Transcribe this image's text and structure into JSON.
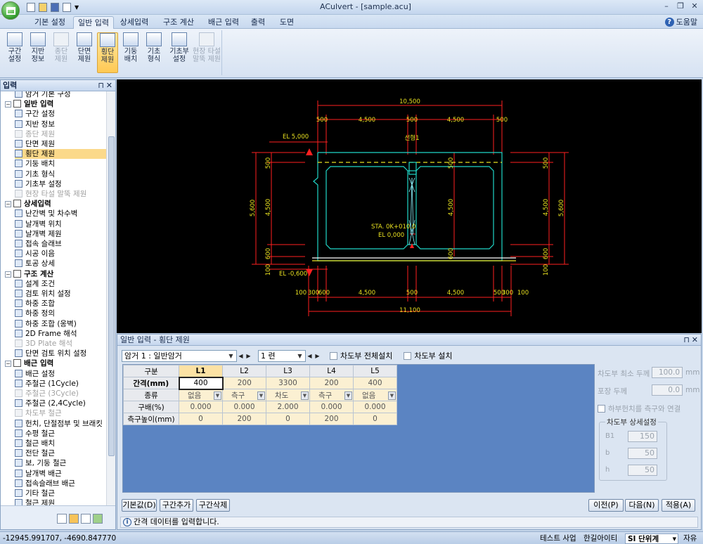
{
  "window": {
    "title": "ACulvert - [sample.acu]"
  },
  "ribbon": {
    "tabs": [
      "기본 설정",
      "일반 입력",
      "상세입력",
      "구조 계산",
      "배근 입력",
      "출력",
      "도면"
    ],
    "active_tab": "일반 입력",
    "help_label": "도움말",
    "buttons": [
      {
        "label1": "구간",
        "label2": "설정",
        "enabled": true
      },
      {
        "label1": "지반",
        "label2": "정보",
        "enabled": true
      },
      {
        "label1": "종단",
        "label2": "제원",
        "enabled": false
      },
      {
        "label1": "단면",
        "label2": "제원",
        "enabled": true
      },
      {
        "label1": "횡단",
        "label2": "제원",
        "enabled": true,
        "selected": true
      },
      {
        "label1": "기둥",
        "label2": "배치",
        "enabled": true
      },
      {
        "label1": "기초",
        "label2": "형식",
        "enabled": true
      },
      {
        "label1": "기초부",
        "label2": "설정",
        "enabled": true
      },
      {
        "label1": "현장 타설",
        "label2": "말뚝 제원",
        "enabled": false
      }
    ]
  },
  "left_panel": {
    "title": "입력",
    "tree": [
      {
        "label": "암거 기본 구성",
        "type": "item",
        "enabled": true
      },
      {
        "label": "일반 입력",
        "type": "group"
      },
      {
        "label": "구간 설정",
        "type": "item",
        "enabled": true
      },
      {
        "label": "지반 정보",
        "type": "item",
        "enabled": true
      },
      {
        "label": "종단 제원",
        "type": "item",
        "enabled": false
      },
      {
        "label": "단면 제원",
        "type": "item",
        "enabled": true
      },
      {
        "label": "횡단 제원",
        "type": "item",
        "enabled": true,
        "selected": true
      },
      {
        "label": "기둥 배치",
        "type": "item",
        "enabled": true
      },
      {
        "label": "기초 형식",
        "type": "item",
        "enabled": true
      },
      {
        "label": "기초부 설정",
        "type": "item",
        "enabled": true
      },
      {
        "label": "현장 타설 말뚝 제원",
        "type": "item",
        "enabled": false
      },
      {
        "label": "상세입력",
        "type": "group"
      },
      {
        "label": "난간벽 및 차수벽",
        "type": "item",
        "enabled": true
      },
      {
        "label": "날개벽 위치",
        "type": "item",
        "enabled": true
      },
      {
        "label": "날개벽 제원",
        "type": "item",
        "enabled": true
      },
      {
        "label": "접속 슬래브",
        "type": "item",
        "enabled": true
      },
      {
        "label": "시공 이음",
        "type": "item",
        "enabled": true
      },
      {
        "label": "토공 상세",
        "type": "item",
        "enabled": true
      },
      {
        "label": "구조 계산",
        "type": "group"
      },
      {
        "label": "설계 조건",
        "type": "item",
        "enabled": true
      },
      {
        "label": "검토 위치 설정",
        "type": "item",
        "enabled": true
      },
      {
        "label": "하중 조합",
        "type": "item",
        "enabled": true
      },
      {
        "label": "하중 정의",
        "type": "item",
        "enabled": true
      },
      {
        "label": "하중 조합 (옹벽)",
        "type": "item",
        "enabled": true
      },
      {
        "label": "2D Frame 해석",
        "type": "item",
        "enabled": true
      },
      {
        "label": "3D Plate 해석",
        "type": "item",
        "enabled": false
      },
      {
        "label": "단면 검토 위치 설정",
        "type": "item",
        "enabled": true
      },
      {
        "label": "배근 입력",
        "type": "group"
      },
      {
        "label": "배근 설정",
        "type": "item",
        "enabled": true
      },
      {
        "label": "주철근 (1Cycle)",
        "type": "item",
        "enabled": true
      },
      {
        "label": "주철근 (3Cycle)",
        "type": "item",
        "enabled": false
      },
      {
        "label": "주철근 (2,4Cycle)",
        "type": "item",
        "enabled": true
      },
      {
        "label": "차도부 철근",
        "type": "item",
        "enabled": false
      },
      {
        "label": "헌치, 단절점부 및 브래킷",
        "type": "item",
        "enabled": true
      },
      {
        "label": "수평 철근",
        "type": "item",
        "enabled": true
      },
      {
        "label": "철근 배치",
        "type": "item",
        "enabled": true
      },
      {
        "label": "전단 철근",
        "type": "item",
        "enabled": true
      },
      {
        "label": "보, 기둥 철근",
        "type": "item",
        "enabled": true
      },
      {
        "label": "날개벽 배근",
        "type": "item",
        "enabled": true
      },
      {
        "label": "접속슬래브 배근",
        "type": "item",
        "enabled": true
      },
      {
        "label": "기타 철근",
        "type": "item",
        "enabled": true
      },
      {
        "label": "철근 제원",
        "type": "item",
        "enabled": true
      }
    ]
  },
  "drawing": {
    "top_total": "10,500",
    "top_dims": [
      "500",
      "4,500",
      "500",
      "4,500",
      "500"
    ],
    "bottom_total": "11,100",
    "bottom_dims": [
      "100",
      "300",
      "600",
      "4,500",
      "500",
      "4,500",
      "500",
      "300",
      "100"
    ],
    "left_total": "5,600",
    "left_dims": [
      "500",
      "4,500",
      "600",
      "100"
    ],
    "right_total": "5,600",
    "right_dims": [
      "500",
      "4,500",
      "600",
      "100"
    ],
    "mid_dims": [
      "500",
      "4,500",
      "600"
    ],
    "el_top": "EL 5,000",
    "el_bottom": "EL -0,600",
    "center_label": "선형1",
    "sta_label": "STA. 0K+010.0",
    "el_center": "EL 0,000"
  },
  "bottom_panel": {
    "title": "일반 입력 - 횡단 제원",
    "culvert_select": "암거 1 : 일반암거",
    "row_select": "1 련",
    "check_all_label": "차도부 전체설치",
    "check_label": "차도부 설치",
    "grid": {
      "corner": "구분",
      "columns": [
        "L1",
        "L2",
        "L3",
        "L4",
        "L5"
      ],
      "rows": [
        {
          "label": "간격(mm)",
          "values": [
            "400",
            "200",
            "3300",
            "200",
            "400"
          ]
        },
        {
          "label": "종류",
          "values": [
            "없음",
            "측구",
            "차도",
            "측구",
            "없음"
          ]
        },
        {
          "label": "구배(%)",
          "values": [
            "0.000",
            "0.000",
            "2.000",
            "0.000",
            "0.000"
          ]
        },
        {
          "label": "측구높이(mm)",
          "values": [
            "0",
            "200",
            "0",
            "200",
            "0"
          ]
        }
      ]
    },
    "options": {
      "min_thickness_label": "차도부 최소 두께",
      "min_thickness_value": "100.0",
      "pave_thickness_label": "포장 두께",
      "pave_thickness_value": "0.0",
      "unit": "mm",
      "connect_label": "하부헌치를 측구와 연결",
      "detail_group": "차도부 상세설정",
      "B1_label": "B1",
      "B1_value": "150",
      "b_label": "b",
      "b_value": "50",
      "h_label": "h",
      "h_value": "50"
    },
    "buttons": {
      "default": "기본값(D)",
      "add": "구간추가",
      "delete": "구간삭제",
      "prev": "이전(P)",
      "next": "다음(N)",
      "apply": "적용(A)"
    },
    "status_message": "간격 데이터를 입력합니다."
  },
  "status_bar": {
    "coords": "-12945.991707,   -4690.847770",
    "test": "테스트 사업",
    "company": "한길아이티",
    "unit_system": "SI 단위계",
    "mode": "자유"
  }
}
